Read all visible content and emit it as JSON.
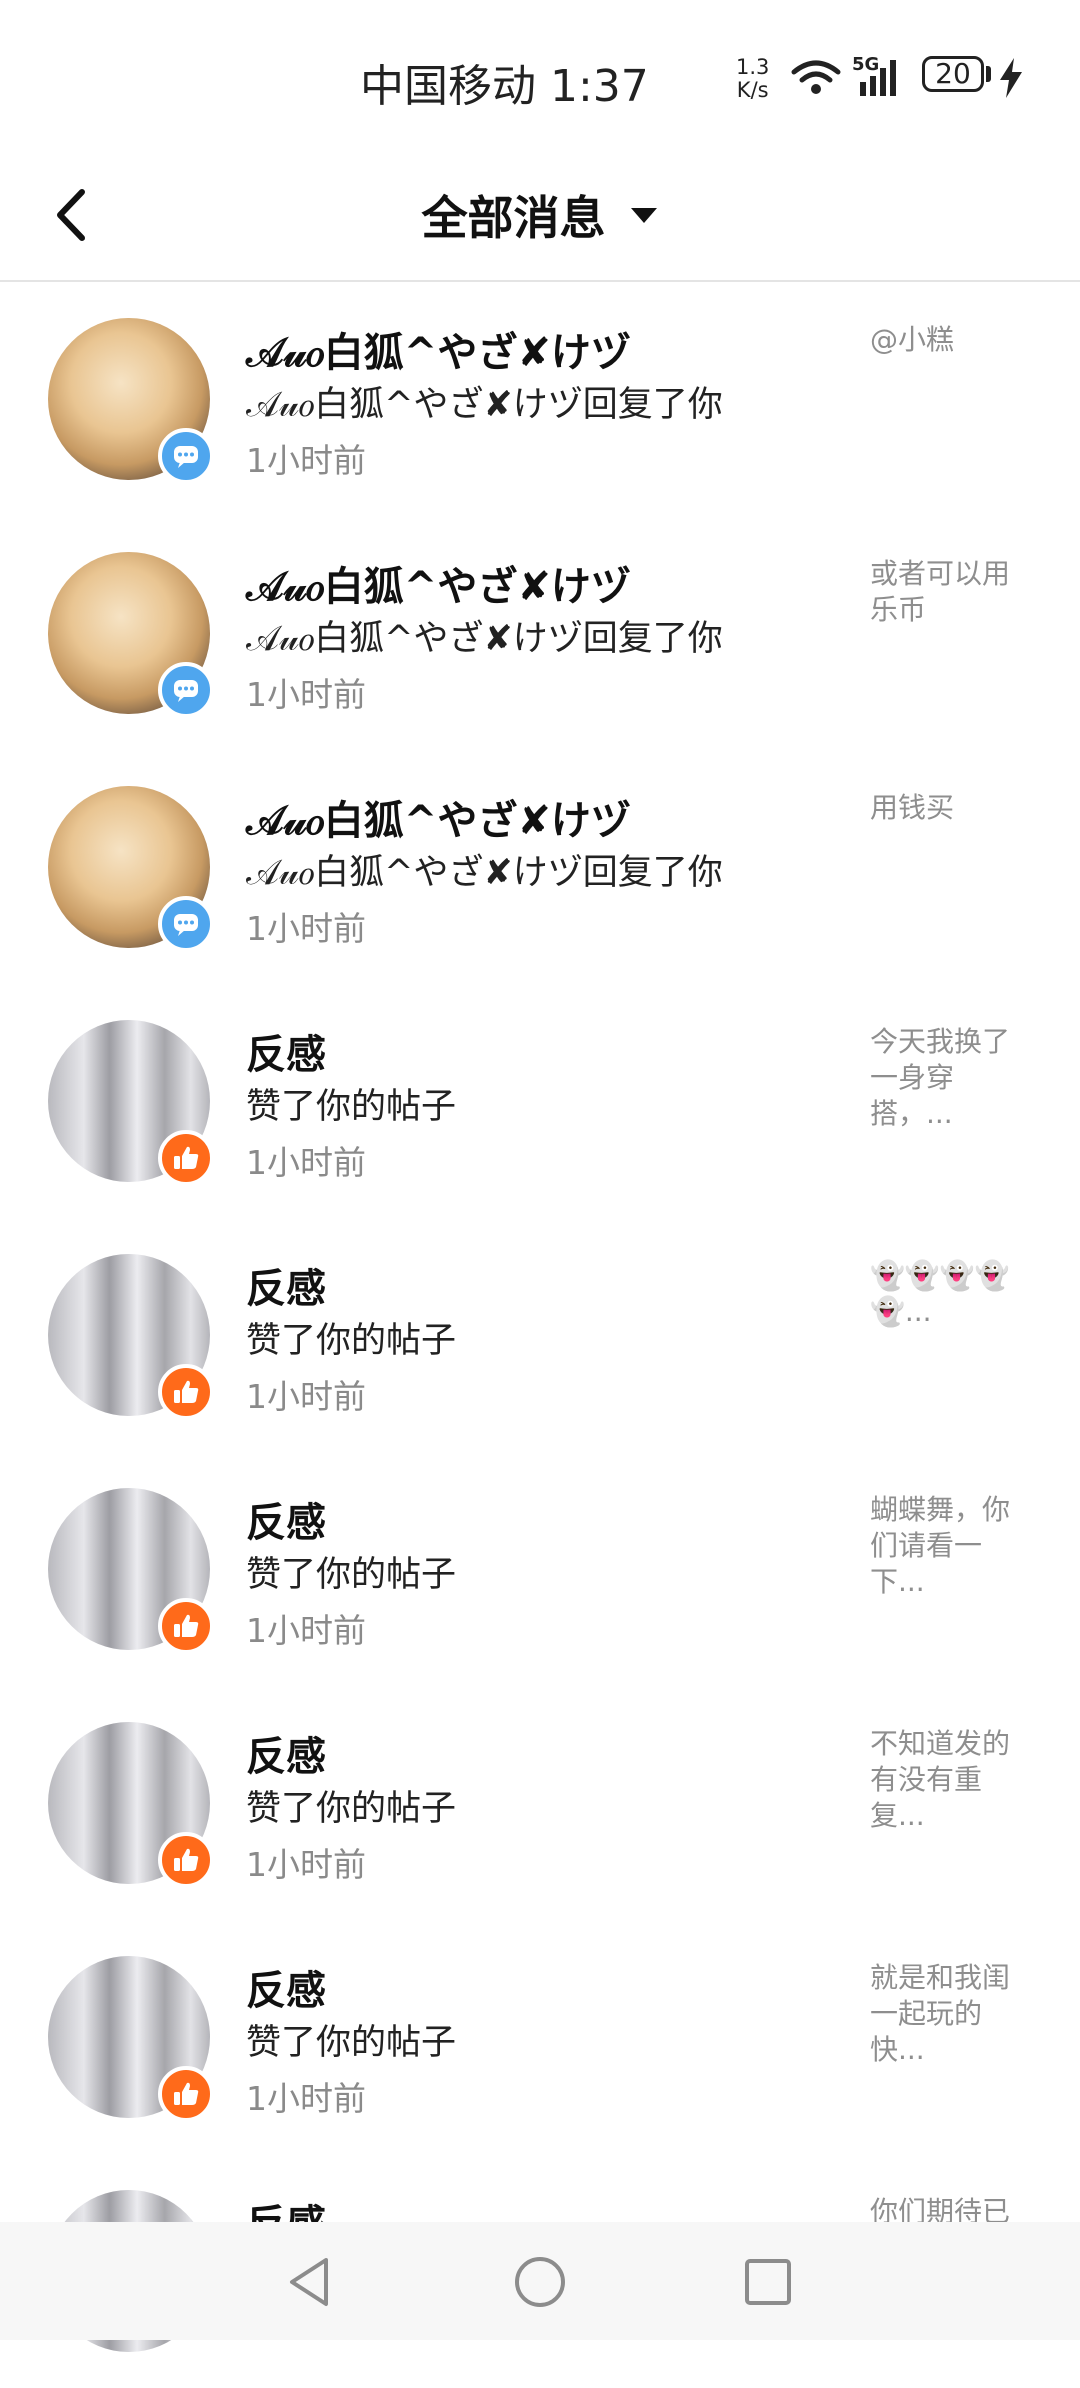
{
  "status_bar": {
    "carrier_time": "中国移动 1:37",
    "net_speed_value": "1.3",
    "net_speed_unit": "K/s",
    "network_label": "5G",
    "battery": "20"
  },
  "header": {
    "title": "全部消息"
  },
  "messages": [
    {
      "name": "𝒜𝓊𝑜白狐^やざ✘けヅ",
      "action": "𝒜𝓊𝑜白狐^やざ✘けヅ回复了你",
      "time": "1小时前",
      "preview": "@小糕",
      "type": "reply"
    },
    {
      "name": "𝒜𝓊𝑜白狐^やざ✘けヅ",
      "action": "𝒜𝓊𝑜白狐^やざ✘けヅ回复了你",
      "time": "1小时前",
      "preview": "或者可以用乐币",
      "type": "reply"
    },
    {
      "name": "𝒜𝓊𝑜白狐^やざ✘けヅ",
      "action": "𝒜𝓊𝑜白狐^やざ✘けヅ回复了你",
      "time": "1小时前",
      "preview": "用钱买",
      "type": "reply"
    },
    {
      "name": "反感",
      "action": "赞了你的帖子",
      "time": "1小时前",
      "preview": "今天我换了一身穿搭，...",
      "type": "like"
    },
    {
      "name": "反感",
      "action": "赞了你的帖子",
      "time": "1小时前",
      "preview": "👻👻👻👻👻...",
      "type": "like"
    },
    {
      "name": "反感",
      "action": "赞了你的帖子",
      "time": "1小时前",
      "preview": "蝴蝶舞，你们请看一下...",
      "type": "like"
    },
    {
      "name": "反感",
      "action": "赞了你的帖子",
      "time": "1小时前",
      "preview": "不知道发的有没有重复...",
      "type": "like"
    },
    {
      "name": "反感",
      "action": "赞了你的帖子",
      "time": "1小时前",
      "preview": "就是和我闺一起玩的快...",
      "type": "like"
    },
    {
      "name": "反感",
      "action": "",
      "time": "",
      "preview": "你们期待已",
      "type": "like"
    }
  ],
  "colors": {
    "reply_badge": "#4fa6ee",
    "like_badge": "#ff6a1a",
    "muted_text": "#8a8a8a"
  }
}
